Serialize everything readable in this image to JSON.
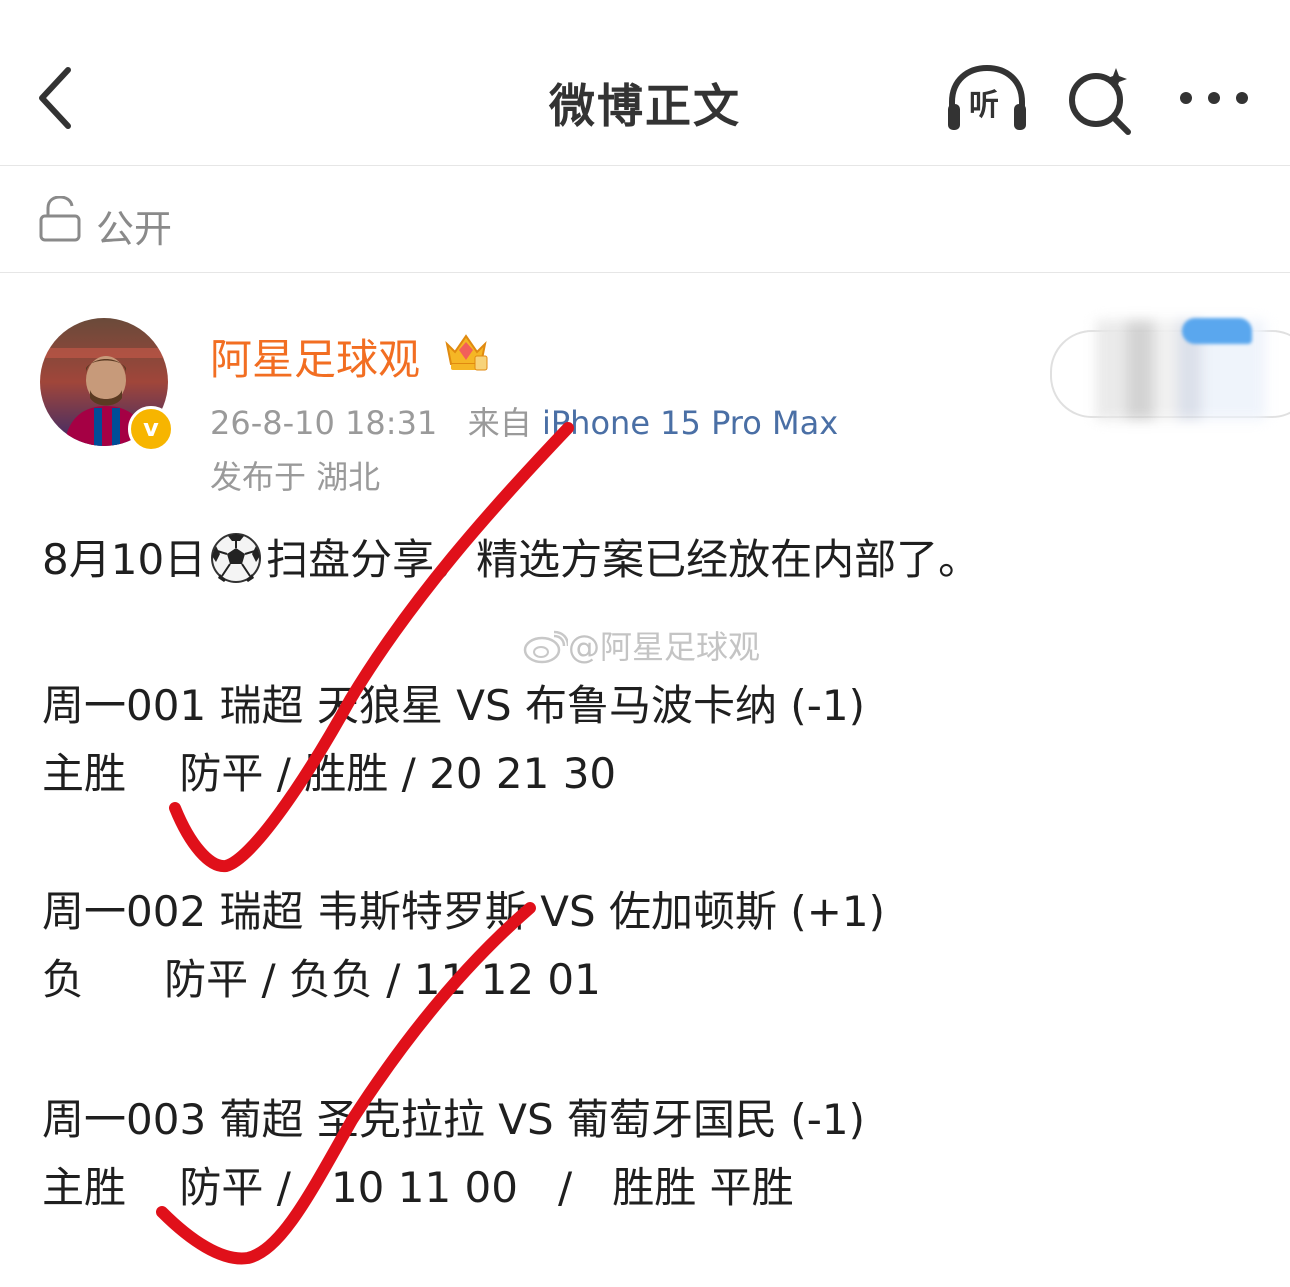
{
  "header": {
    "title": "微博正文",
    "listen_label": "听"
  },
  "privacy": {
    "label": "公开"
  },
  "post": {
    "author": "阿星足球观",
    "time": "26-8-10 18:31",
    "source_prefix": "来自",
    "device": "iPhone 15 Pro Max",
    "location": "发布于 湖北",
    "intro_before": "8月10日",
    "intro_after": "扫盘分享，精选方案已经放在内部了。",
    "watermark": "@阿星足球观",
    "matches": [
      {
        "title": "周一001 瑞超 天狼星 VS 布鲁马波卡纳 (-1)",
        "pick": "主胜    防平 / 胜胜 / 20 21 30"
      },
      {
        "title": "周一002 瑞超 韦斯特罗斯 VS 佐加顿斯 (+1)",
        "pick": "负      防平 / 负负 / 11 12 01"
      },
      {
        "title": "周一003 葡超 圣克拉拉 VS 葡萄牙国民 (-1)",
        "pick": "主胜    防平 /   10 11 00   /   胜胜 平胜"
      }
    ]
  },
  "icons": {
    "back": "chevron-left-icon",
    "listen": "headphones-icon",
    "search": "search-icon",
    "more": "more-dots-icon",
    "lock": "lock-open-icon",
    "verified": "verified-v-icon",
    "crown": "crown-badge-icon",
    "ball": "soccer-ball-icon",
    "weibo": "weibo-logo-icon"
  },
  "colors": {
    "username": "#f26e22",
    "device_link": "#4a6fa5",
    "meta": "#9a9a9a",
    "check_marks": "#e0101a",
    "verified_badge": "#f7b500"
  }
}
